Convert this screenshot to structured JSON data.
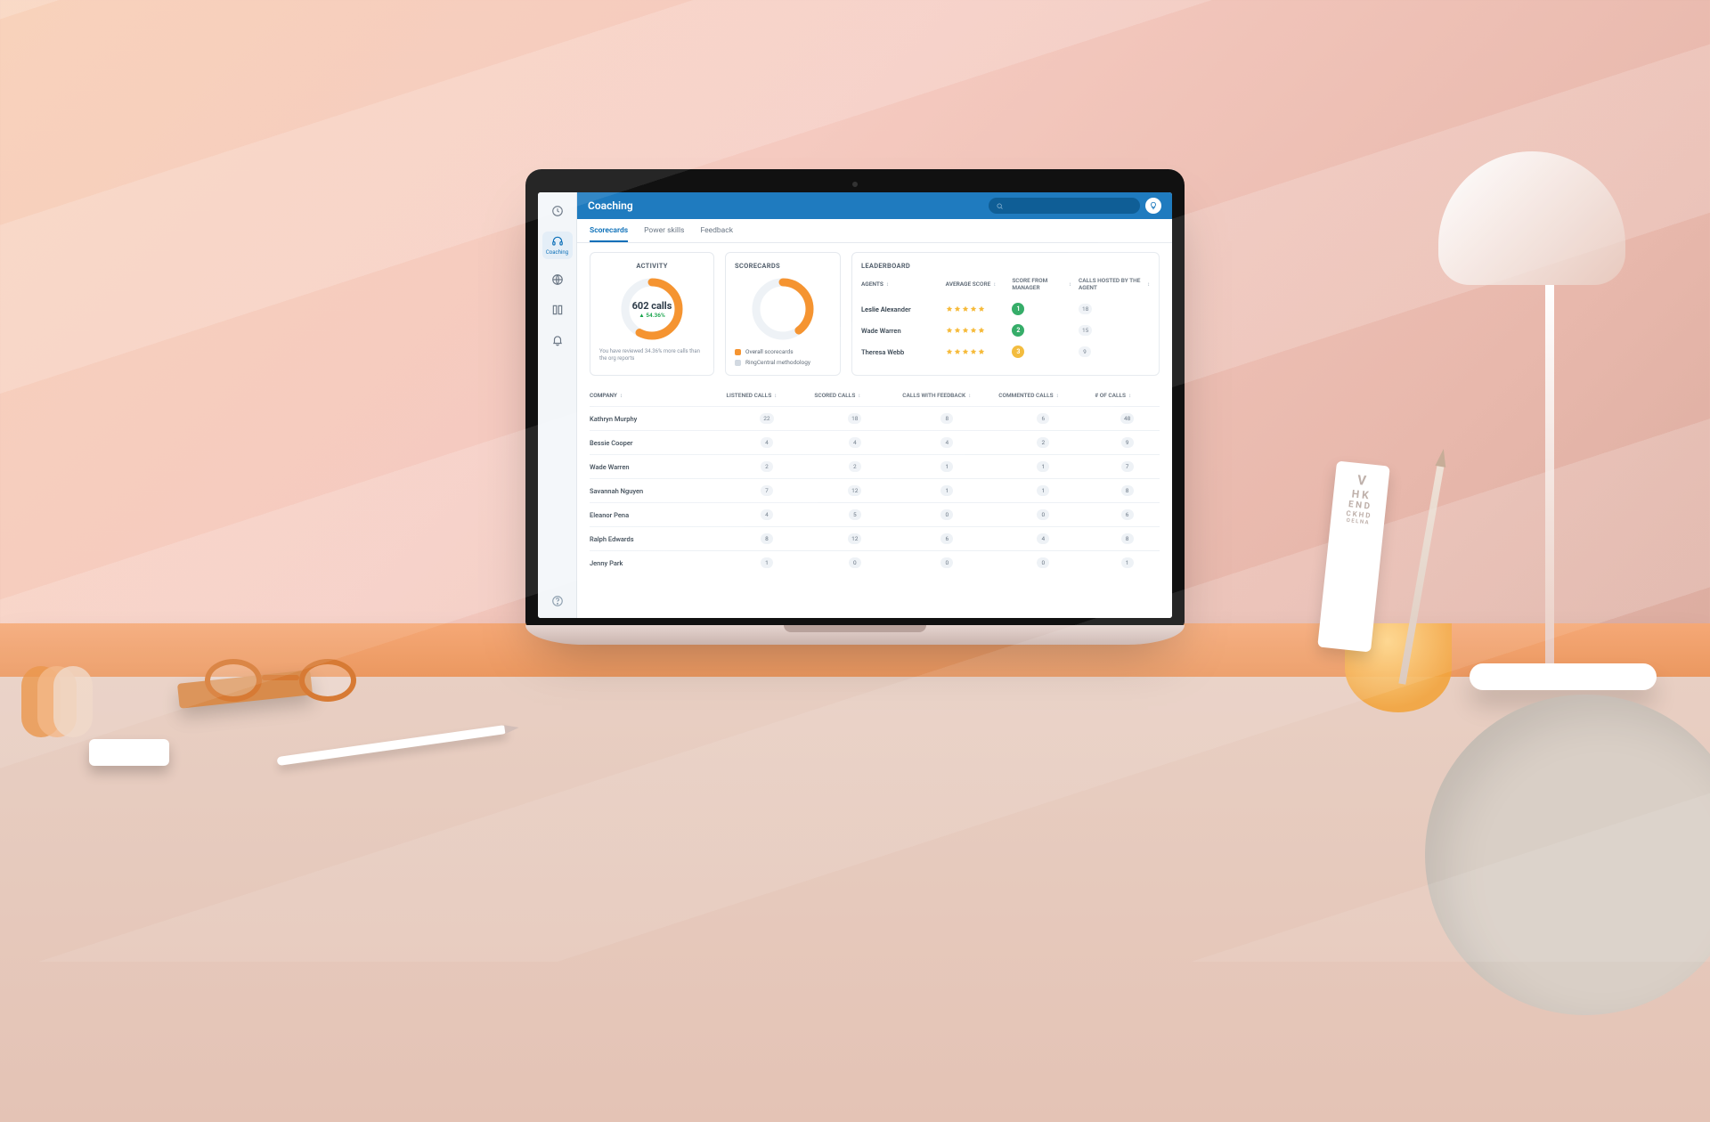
{
  "header": {
    "title": "Coaching",
    "search_placeholder": ""
  },
  "sidebar": {
    "items": [
      {
        "icon": "clock",
        "label": ""
      },
      {
        "icon": "headset",
        "label": "Coaching"
      },
      {
        "icon": "globe",
        "label": ""
      },
      {
        "icon": "library",
        "label": ""
      },
      {
        "icon": "bell",
        "label": ""
      }
    ]
  },
  "tabs": [
    "Scorecards",
    "Power skills",
    "Feedback"
  ],
  "activity": {
    "title": "ACTIVITY",
    "value": "602 calls",
    "delta": "▲ 54.36%",
    "percent": 62,
    "caption": "You have reviewed 34.36% more calls than the org reports"
  },
  "scorecards": {
    "title": "SCORECARDS",
    "percent": 40,
    "legend": [
      {
        "color": "orange",
        "label": "Overall scorecards"
      },
      {
        "color": "grey",
        "label": "RingCentral methodology"
      }
    ]
  },
  "leaderboard": {
    "title": "LEADERBOARD",
    "columns": [
      "AGENTS",
      "AVERAGE SCORE",
      "SCORE FROM MANAGER",
      "CALLS HOSTED BY THE AGENT"
    ],
    "rows": [
      {
        "name": "Leslie Alexander",
        "stars": 5.0,
        "mgr": {
          "value": "1",
          "tone": "green"
        },
        "hosted": "18"
      },
      {
        "name": "Wade Warren",
        "stars": 4.5,
        "mgr": {
          "value": "2",
          "tone": "green"
        },
        "hosted": "15"
      },
      {
        "name": "Theresa Webb",
        "stars": 4.5,
        "mgr": {
          "value": "3",
          "tone": "amber"
        },
        "hosted": "9"
      }
    ]
  },
  "table": {
    "columns": [
      "COMPANY",
      "LISTENED CALLS",
      "SCORED CALLS",
      "CALLS WITH FEEDBACK",
      "COMMENTED CALLS",
      "# OF CALLS"
    ],
    "rows": [
      {
        "name": "Kathryn Murphy",
        "listened": "22",
        "scored": "18",
        "feedback": "8",
        "commented": "6",
        "count": "48"
      },
      {
        "name": "Bessie Cooper",
        "listened": "4",
        "scored": "4",
        "feedback": "4",
        "commented": "2",
        "count": "9"
      },
      {
        "name": "Wade Warren",
        "listened": "2",
        "scored": "2",
        "feedback": "1",
        "commented": "1",
        "count": "7"
      },
      {
        "name": "Savannah Nguyen",
        "listened": "7",
        "scored": "12",
        "feedback": "1",
        "commented": "1",
        "count": "8"
      },
      {
        "name": "Eleanor Pena",
        "listened": "4",
        "scored": "5",
        "feedback": "0",
        "commented": "0",
        "count": "6"
      },
      {
        "name": "Ralph Edwards",
        "listened": "8",
        "scored": "12",
        "feedback": "6",
        "commented": "4",
        "count": "8"
      },
      {
        "name": "Jenny Park",
        "listened": "1",
        "scored": "0",
        "feedback": "0",
        "commented": "0",
        "count": "1"
      }
    ]
  },
  "eyetest": [
    "V",
    "H K",
    "E N D",
    "C K H D",
    "O E L N A"
  ]
}
